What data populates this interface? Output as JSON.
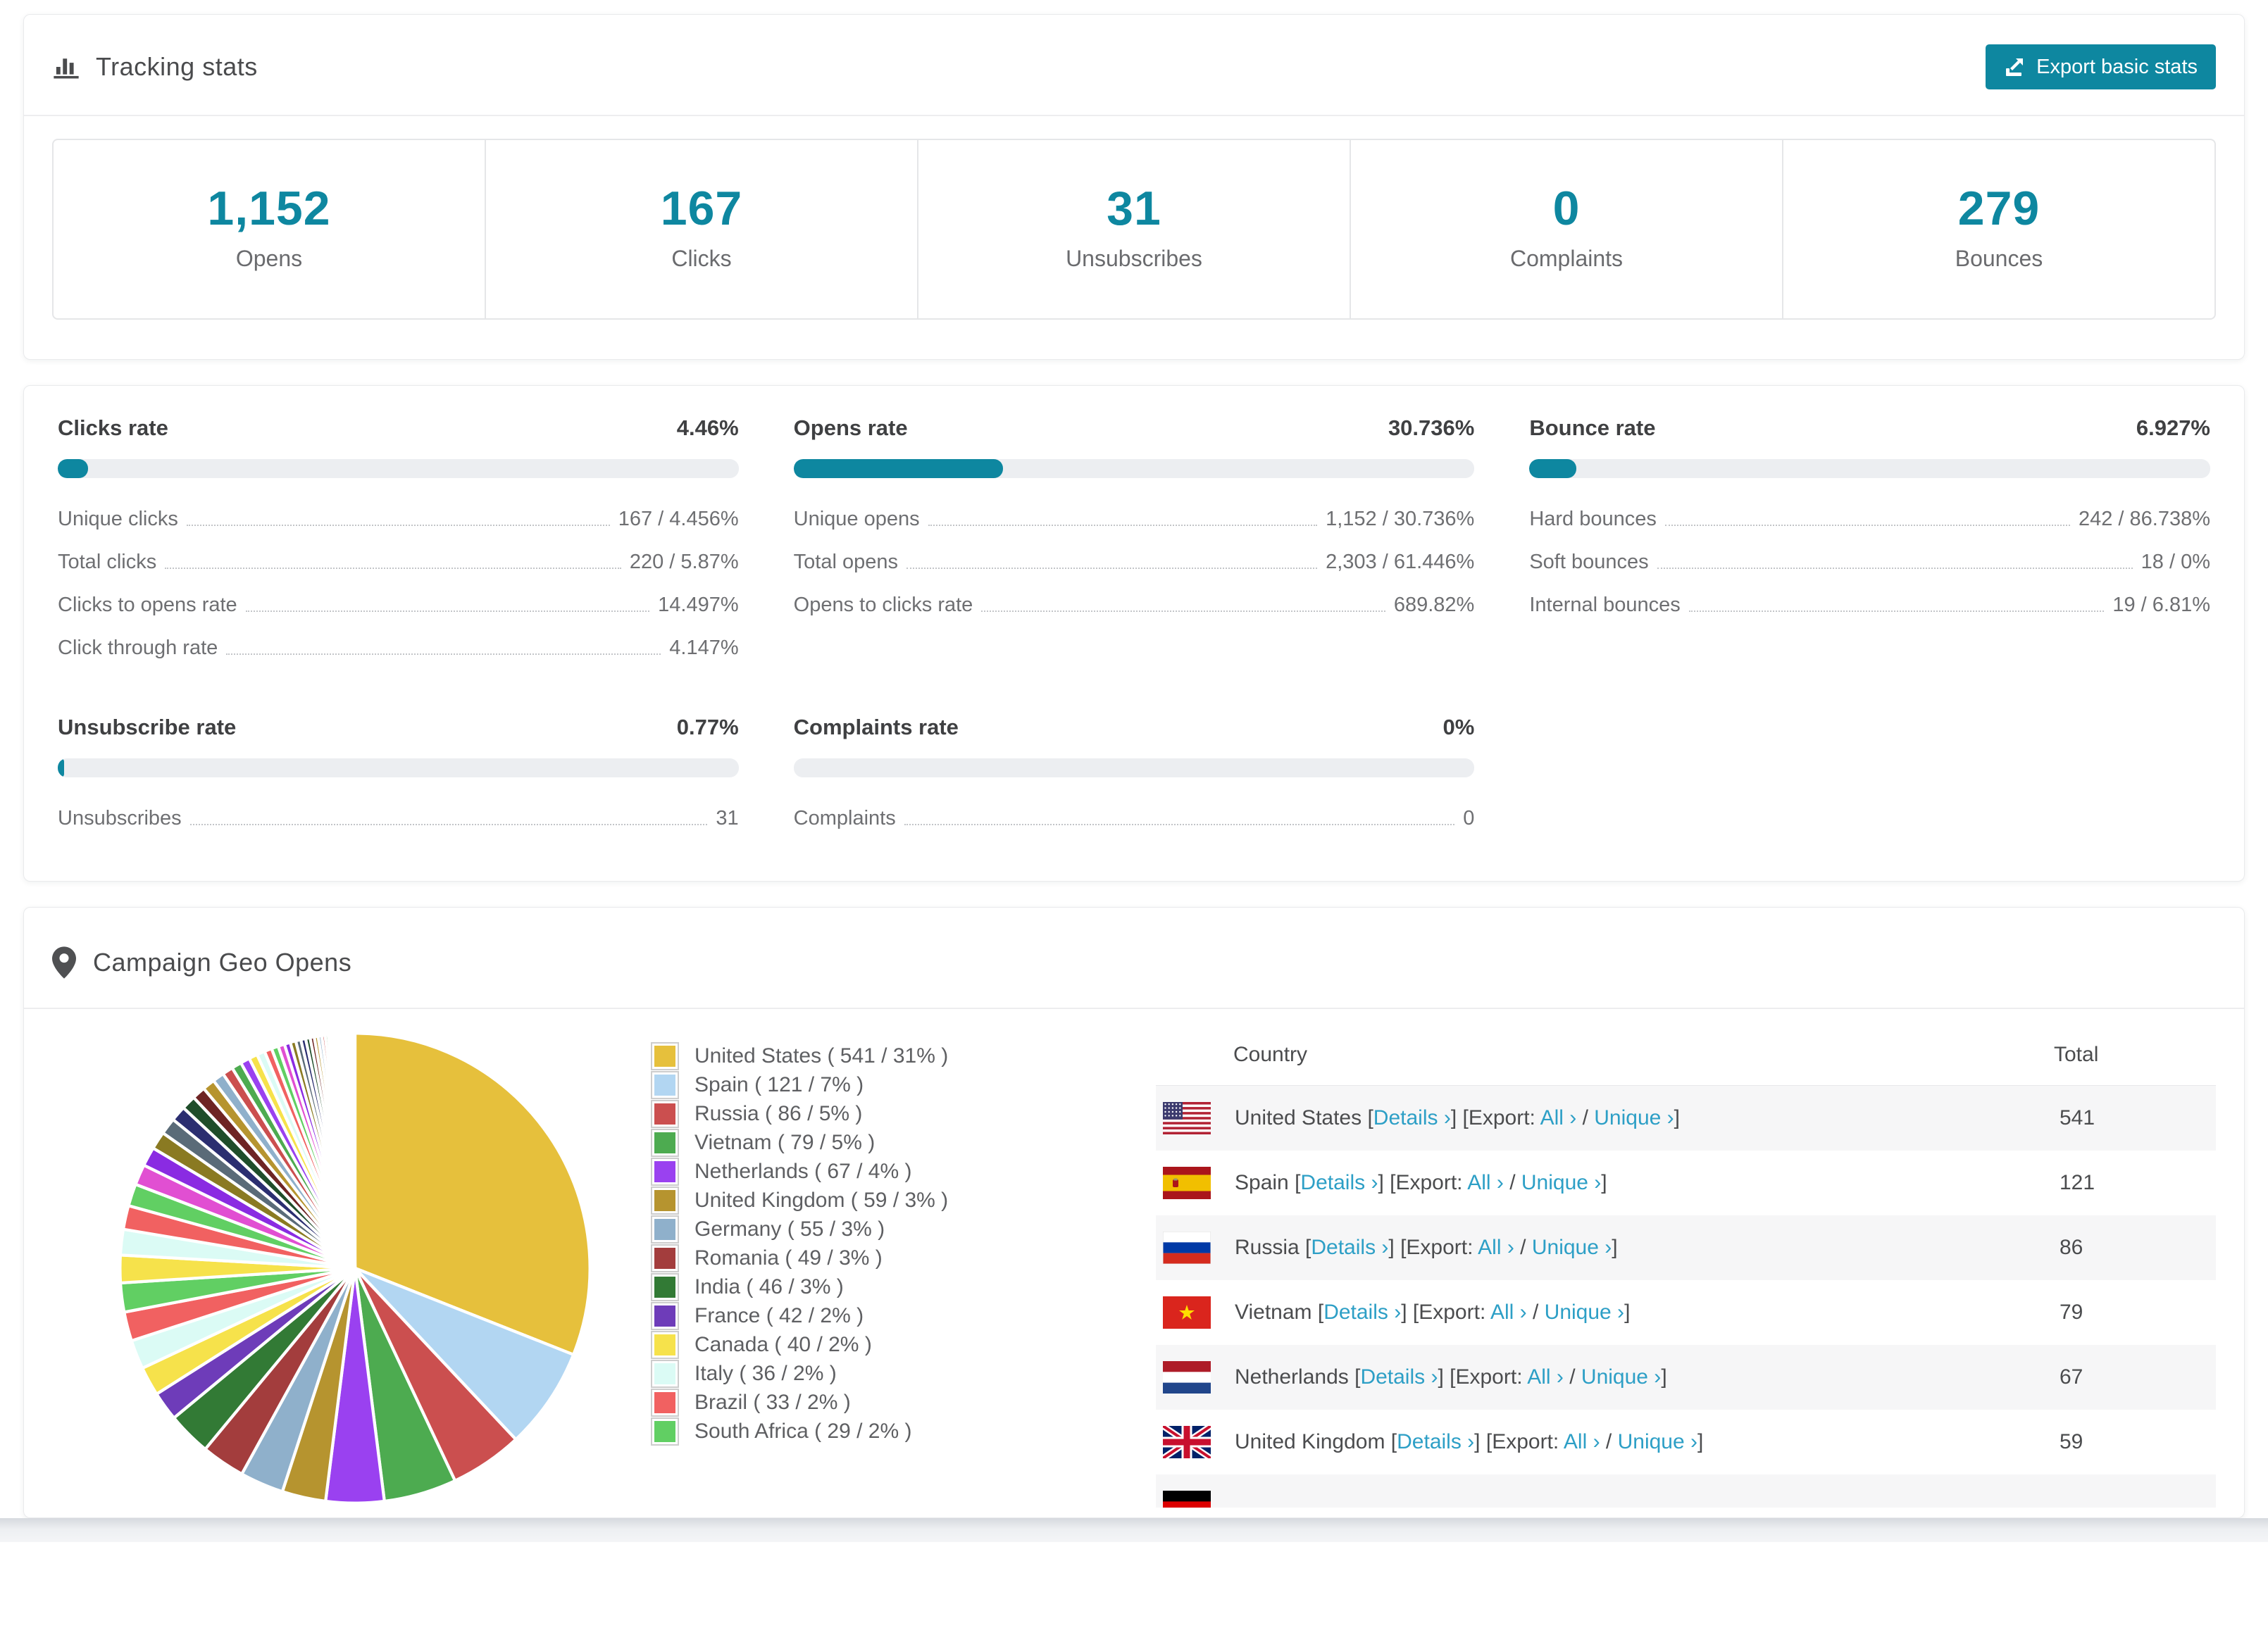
{
  "colors": {
    "accent": "#0e87a0",
    "link": "#2d9fc6",
    "bar_track": "#eceef1",
    "row_stripe": "#f6f6f7"
  },
  "tracking": {
    "title": "Tracking stats",
    "export_label": "Export basic stats",
    "stats": [
      {
        "value": "1,152",
        "label": "Opens"
      },
      {
        "value": "167",
        "label": "Clicks"
      },
      {
        "value": "31",
        "label": "Unsubscribes"
      },
      {
        "value": "0",
        "label": "Complaints"
      },
      {
        "value": "279",
        "label": "Bounces"
      }
    ]
  },
  "rates": [
    {
      "title": "Clicks rate",
      "value": "4.46%",
      "percent": 4.46,
      "rows": [
        {
          "label": "Unique clicks",
          "value": "167 / 4.456%"
        },
        {
          "label": "Total clicks",
          "value": "220 / 5.87%"
        },
        {
          "label": "Clicks to opens rate",
          "value": "14.497%"
        },
        {
          "label": "Click through rate",
          "value": "4.147%"
        }
      ]
    },
    {
      "title": "Opens rate",
      "value": "30.736%",
      "percent": 30.736,
      "rows": [
        {
          "label": "Unique opens",
          "value": "1,152 / 30.736%"
        },
        {
          "label": "Total opens",
          "value": "2,303 / 61.446%"
        },
        {
          "label": "Opens to clicks rate",
          "value": "689.82%"
        }
      ]
    },
    {
      "title": "Bounce rate",
      "value": "6.927%",
      "percent": 6.927,
      "rows": [
        {
          "label": "Hard bounces",
          "value": "242 / 86.738%"
        },
        {
          "label": "Soft bounces",
          "value": "18 / 0%"
        },
        {
          "label": "Internal bounces",
          "value": "19 / 6.81%"
        }
      ]
    },
    {
      "title": "Unsubscribe rate",
      "value": "0.77%",
      "percent": 0.77,
      "rows": [
        {
          "label": "Unsubscribes",
          "value": "31"
        }
      ]
    },
    {
      "title": "Complaints rate",
      "value": "0%",
      "percent": 0,
      "rows": [
        {
          "label": "Complaints",
          "value": "0"
        }
      ]
    }
  ],
  "geo": {
    "title": "Campaign Geo Opens",
    "table": {
      "headers": [
        "Country",
        "Total"
      ],
      "links": {
        "details": "Details ›",
        "export_prefix": "Export:",
        "all": "All ›",
        "unique": "Unique ›"
      },
      "rows": [
        {
          "country": "United States",
          "flag": "us",
          "total": "541"
        },
        {
          "country": "Spain",
          "flag": "es",
          "total": "121"
        },
        {
          "country": "Russia",
          "flag": "ru",
          "total": "86"
        },
        {
          "country": "Vietnam",
          "flag": "vn",
          "total": "79"
        },
        {
          "country": "Netherlands",
          "flag": "nl",
          "total": "67"
        },
        {
          "country": "United Kingdom",
          "flag": "gb",
          "total": "59"
        }
      ],
      "partial_row_flag": "de"
    },
    "chart_data": {
      "type": "pie",
      "legend_position": "right",
      "start_angle_deg": -90,
      "series": [
        {
          "name": "United States",
          "value": 541,
          "percent": 31,
          "color": "#e6c03c"
        },
        {
          "name": "Spain",
          "value": 121,
          "percent": 7,
          "color": "#b2d6f2"
        },
        {
          "name": "Russia",
          "value": 86,
          "percent": 5,
          "color": "#cb4f4f"
        },
        {
          "name": "Vietnam",
          "value": 79,
          "percent": 5,
          "color": "#4dab50"
        },
        {
          "name": "Netherlands",
          "value": 67,
          "percent": 4,
          "color": "#9a41f0"
        },
        {
          "name": "United Kingdom",
          "value": 59,
          "percent": 3,
          "color": "#b6942f"
        },
        {
          "name": "Germany",
          "value": 55,
          "percent": 3,
          "color": "#8fb0cb"
        },
        {
          "name": "Romania",
          "value": 49,
          "percent": 3,
          "color": "#a33d3d"
        },
        {
          "name": "India",
          "value": 46,
          "percent": 3,
          "color": "#327a35"
        },
        {
          "name": "France",
          "value": 42,
          "percent": 2,
          "color": "#6e3cb9"
        },
        {
          "name": "Canada",
          "value": 40,
          "percent": 2,
          "color": "#f6e24b"
        },
        {
          "name": "Italy",
          "value": 36,
          "percent": 2,
          "color": "#dbfbf5"
        },
        {
          "name": "Brazil",
          "value": 33,
          "percent": 2,
          "color": "#f16161"
        },
        {
          "name": "South Africa",
          "value": 29,
          "percent": 2,
          "color": "#61cf63"
        }
      ],
      "unlabeled_tail": {
        "slice_count": 45,
        "first_percent": 1.9,
        "decay": 0.93,
        "total_percent": 26,
        "palette": [
          "#f6e24b",
          "#dbfbf5",
          "#f16161",
          "#61cf63",
          "#e14fd2",
          "#8a2be2",
          "#8a7a22",
          "#5a6b78",
          "#2b2e70",
          "#1f4d2a",
          "#6e2424",
          "#b6942f",
          "#8fb0cb",
          "#cb4f4f",
          "#4dab50",
          "#9a41f0"
        ]
      }
    }
  }
}
